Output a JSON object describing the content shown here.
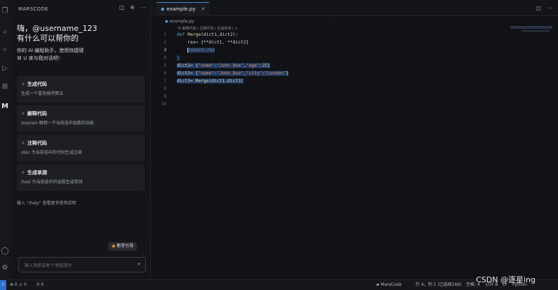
{
  "sidebar": {
    "title": "MARSCODE",
    "greeting_line1": "嗨，@username_123",
    "greeting_line2": "有什么可以帮你的",
    "desc_line1": "你的 AI 编程助手，使用快捷键",
    "desc_line2": "⌘ U 来与我对话吧!",
    "cards": [
      {
        "title": "生成代码",
        "desc": "生成一个冒泡排序算法"
      },
      {
        "title": "解释代码",
        "desc": "/explain 解释一下当前选中函数的功能"
      },
      {
        "title": "注释代码",
        "desc": "/doc 为当前选中的代码生成注释"
      },
      {
        "title": "生成单测",
        "desc": "/test 为当前选中的函数生成单测"
      }
    ],
    "help_text": "输入 \"/help\" 查看更多使用说明",
    "guide_button": "新手引导",
    "chat_placeholder": "输入消息或者\"/\"唤起指令"
  },
  "editor": {
    "tab_name": "example.py",
    "breadcrumb": "example.py",
    "codelens": "Ⓜ 解释代码 | 注释代码 | 生成单测 | ×",
    "line_numbers": [
      "1",
      "2",
      "3",
      "4",
      "5",
      "6",
      "7",
      "8",
      "9",
      "10"
    ],
    "active_line": 3
  },
  "statusbar": {
    "remote": "⚡",
    "problems": "⊗ 0  ⚠ 0",
    "ports": "⚲ 0",
    "marscode": "MarsCode",
    "position": "行 4，列 1 (已选择166)",
    "spaces": "空格: 4",
    "encoding": "UTF-8",
    "eol": "LF",
    "language": "Python"
  },
  "watermark": "CSDN @逐星ing",
  "colors": {
    "accent": "#2f6fd1",
    "selection": "#223a5e",
    "keyword": "#569cd6",
    "string": "#ce9178"
  }
}
